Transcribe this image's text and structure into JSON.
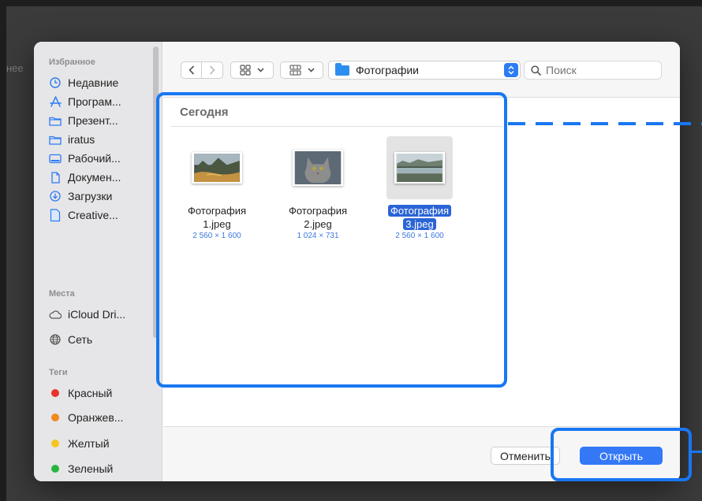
{
  "backdrop": {
    "text": "нее"
  },
  "sidebar": {
    "sections": {
      "favorites": "Избранное",
      "places": "Места",
      "tags": "Теги"
    },
    "favorites": [
      {
        "label": "Недавние",
        "icon": "clock-icon"
      },
      {
        "label": "Програм...",
        "icon": "apps-icon"
      },
      {
        "label": "Презент...",
        "icon": "folder-icon"
      },
      {
        "label": "iratus",
        "icon": "folder-icon"
      },
      {
        "label": "Рабочий...",
        "icon": "desktop-icon"
      },
      {
        "label": "Докумен...",
        "icon": "document-icon"
      },
      {
        "label": "Загрузки",
        "icon": "download-icon"
      },
      {
        "label": "Creative...",
        "icon": "file-icon"
      }
    ],
    "places": [
      {
        "label": "iCloud Dri...",
        "icon": "cloud-icon"
      },
      {
        "label": "Сеть",
        "icon": "globe-icon"
      }
    ],
    "tags": [
      {
        "label": "Красный",
        "color": "#e8332c"
      },
      {
        "label": "Оранжев...",
        "color": "#f08a1c"
      },
      {
        "label": "Желтый",
        "color": "#f4c51e"
      },
      {
        "label": "Зеленый",
        "color": "#27b53f"
      }
    ]
  },
  "toolbar": {
    "location": "Фотографии",
    "search_placeholder": "Поиск"
  },
  "content": {
    "section_title": "Сегодня",
    "files": [
      {
        "name_line1": "Фотография",
        "name_line2": "1.jpeg",
        "dimensions": "2 560 × 1 600",
        "selected": false
      },
      {
        "name_line1": "Фотография",
        "name_line2": "2.jpeg",
        "dimensions": "1 024 × 731",
        "selected": false
      },
      {
        "name_line1": "Фотография",
        "name_line2": "3.jpeg",
        "dimensions": "2 560 × 1 600",
        "selected": true
      }
    ]
  },
  "buttons": {
    "cancel": "Отменить",
    "open": "Открыть"
  },
  "colors": {
    "accent": "#3478f6",
    "highlight": "#1877f2",
    "selection": "#2a64d6"
  }
}
